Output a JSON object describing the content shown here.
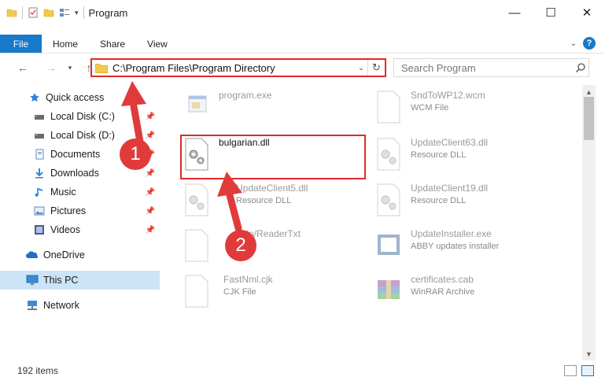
{
  "window": {
    "title": "Program",
    "minimize": "—",
    "maximize": "☐",
    "close": "✕"
  },
  "ribbon": {
    "file": "File",
    "tabs": [
      "Home",
      "Share",
      "View"
    ],
    "help": "?"
  },
  "nav": {
    "address": "C:\\Program Files\\Program Directory",
    "search_placeholder": "Search Program"
  },
  "sidebar": {
    "items": [
      {
        "label": "Quick access",
        "icon": "star-icon"
      },
      {
        "label": "Local Disk (C:)",
        "icon": "drive-icon",
        "pinned": true
      },
      {
        "label": "Local Disk (D:)",
        "icon": "drive-icon",
        "pinned": true
      },
      {
        "label": "Documents",
        "icon": "documents-icon",
        "pinned": true
      },
      {
        "label": "Downloads",
        "icon": "downloads-icon",
        "pinned": true
      },
      {
        "label": "Music",
        "icon": "music-icon",
        "pinned": true
      },
      {
        "label": "Pictures",
        "icon": "pictures-icon",
        "pinned": true
      },
      {
        "label": "Videos",
        "icon": "videos-icon",
        "pinned": true
      },
      {
        "label": "OneDrive",
        "icon": "onedrive-icon"
      },
      {
        "label": "This PC",
        "icon": "computer-icon",
        "selected": true
      },
      {
        "label": "Network",
        "icon": "network-icon"
      }
    ]
  },
  "files": [
    {
      "name": "program.exe",
      "type": "",
      "icon": "exe-icon",
      "faded": true
    },
    {
      "name": "SndToWP12.wcm",
      "type": "WCM File",
      "icon": "blank-file-icon",
      "faded": true
    },
    {
      "name": "bulgarian.dll",
      "type": "",
      "icon": "dll-gear-icon",
      "faded": false
    },
    {
      "name": "UpdateClient63.dll",
      "type": "Resource DLL",
      "icon": "dll-gear-icon",
      "faded": true
    },
    {
      "name": "UpdateClient5.dll",
      "type": "Resource DLL",
      "icon": "dll-gear-icon",
      "faded": true
    },
    {
      "name": "UpdateClient19.dll",
      "type": "Resource DLL",
      "icon": "dll-gear-icon",
      "faded": true
    },
    {
      "name": "help/ReaderTxt",
      "type": "",
      "icon": "blank-file-icon",
      "faded": true
    },
    {
      "name": "UpdateInstaller.exe",
      "type": "ABBY updates installer",
      "icon": "installer-icon",
      "faded": true
    },
    {
      "name": "FastNml.cjk",
      "type": "CJK File",
      "icon": "blank-file-icon",
      "faded": true
    },
    {
      "name": "certificates.cab",
      "type": "WinRAR Archive",
      "icon": "winrar-icon",
      "faded": true
    }
  ],
  "status": {
    "count": "192 items"
  },
  "annotations": {
    "step1": "1",
    "step2": "2"
  },
  "colors": {
    "accent": "#1979ca",
    "highlight": "#e02a2a",
    "selected": "#cce4f7"
  }
}
